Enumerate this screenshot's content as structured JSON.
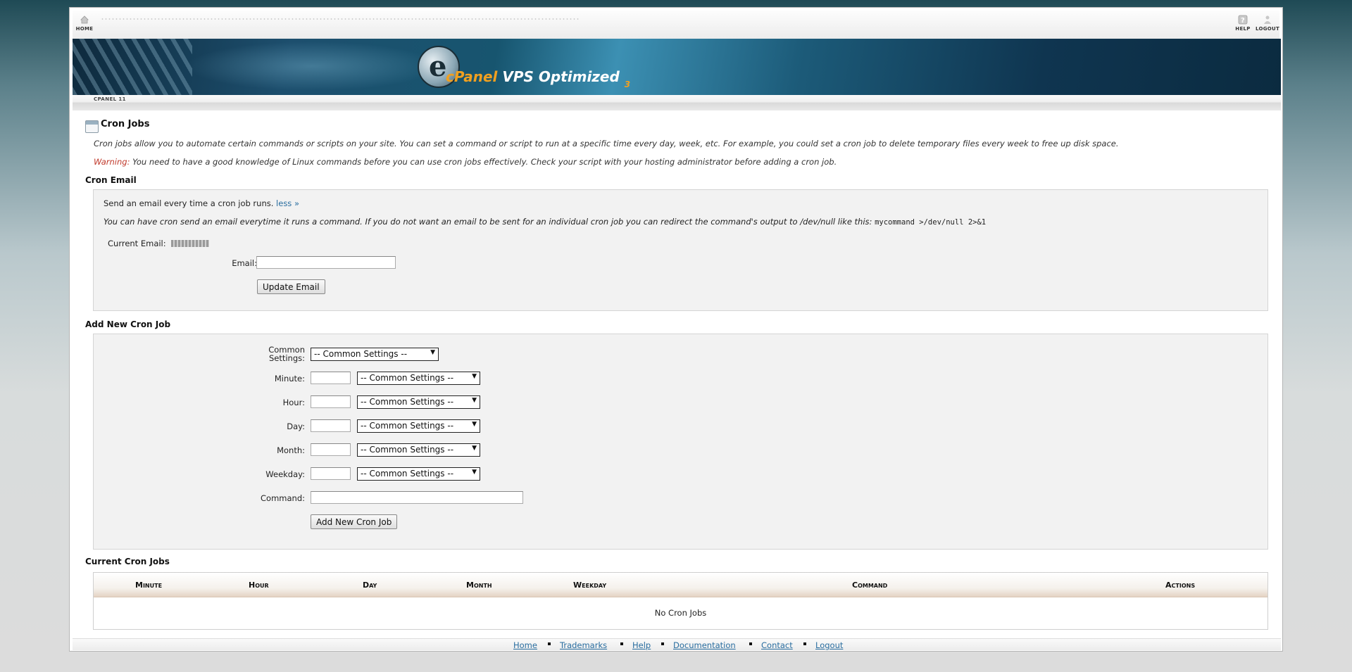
{
  "topnav": {
    "home": "HOME",
    "help": "HELP",
    "logout": "LOGOUT"
  },
  "banner": {
    "logo_c": "cPanel",
    "logo_v": "VPS Optimized",
    "logo_n": "3"
  },
  "cpanel_version": "CPANEL 11",
  "page": {
    "title": "Cron Jobs",
    "intro": "Cron jobs allow you to automate certain commands or scripts on your site. You can set a command or script to run at a specific time every day, week, etc. For example, you could set a cron job to delete temporary files every week to free up disk space.",
    "warning_label": "Warning:",
    "warning_text": " You need to have a good knowledge of Linux commands before you can use cron jobs effectively. Check your script with your hosting administrator before adding a cron job."
  },
  "cron_email": {
    "heading": "Cron Email",
    "send_text": "Send an email every time a cron job runs. ",
    "less_link": "less »",
    "info_text": "You can have cron send an email everytime it runs a command. If you do not want an email to be sent for an individual cron job you can redirect the command's output to /dev/null like this: ",
    "info_code": "mycommand >/dev/null 2>&1",
    "current_email_label": "Current Email:",
    "email_label": "Email:",
    "email_value": "",
    "update_button": "Update Email"
  },
  "add_cron": {
    "heading": "Add New Cron Job",
    "common_settings_label_1": "Common",
    "common_settings_label_2": "Settings:",
    "common_settings_value": "-- Common Settings --",
    "fields": [
      {
        "label": "Minute:",
        "value": "",
        "select": "-- Common Settings --"
      },
      {
        "label": "Hour:",
        "value": "",
        "select": "-- Common Settings --"
      },
      {
        "label": "Day:",
        "value": "",
        "select": "-- Common Settings --"
      },
      {
        "label": "Month:",
        "value": "",
        "select": "-- Common Settings --"
      },
      {
        "label": "Weekday:",
        "value": "",
        "select": "-- Common Settings --"
      }
    ],
    "command_label": "Command:",
    "command_value": "",
    "add_button": "Add New Cron Job"
  },
  "current_cron": {
    "heading": "Current Cron Jobs",
    "columns": [
      "Minute",
      "Hour",
      "Day",
      "Month",
      "Weekday",
      "Command",
      "Actions"
    ],
    "empty_text": "No Cron Jobs"
  },
  "footer": {
    "links": [
      "Home",
      "Trademarks",
      "Help",
      "Documentation",
      "Contact",
      "Logout"
    ]
  },
  "colors": {
    "link": "#2a6ea0",
    "warning": "#c0392b",
    "panel_bg": "#f2f2f2",
    "accent_orange": "#f0a020"
  }
}
